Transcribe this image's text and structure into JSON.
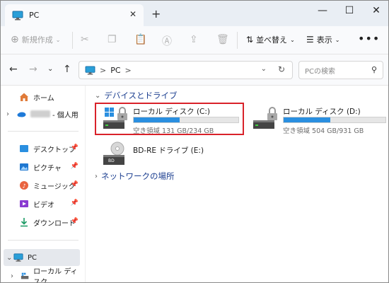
{
  "tab": {
    "title": "PC",
    "close": "✕",
    "new": "+"
  },
  "window_controls": {
    "minimize": "—",
    "maximize": "☐",
    "close": "✕"
  },
  "command_bar": {
    "new_label": "新規作成",
    "sort_label": "並べ替え",
    "view_label": "表示",
    "more_label": "•••"
  },
  "address": {
    "path_root": "PC",
    "sep": ">",
    "search_placeholder": "PCの検索"
  },
  "sidebar": {
    "home": "ホーム",
    "personal_suffix": "- 個人用",
    "pinned": [
      {
        "label": "デスクトップ",
        "icon": "desktop-icon"
      },
      {
        "label": "ピクチャ",
        "icon": "pictures-icon"
      },
      {
        "label": "ミュージック",
        "icon": "music-icon"
      },
      {
        "label": "ビデオ",
        "icon": "video-icon"
      },
      {
        "label": "ダウンロード",
        "icon": "download-icon"
      }
    ],
    "pc": "PC",
    "local_disk": "ローカル ディスク"
  },
  "main": {
    "devices_header": "デバイスとドライブ",
    "network_header": "ネットワークの場所",
    "drives": [
      {
        "name": "ローカル ディスク (C:)",
        "free_text": "空き領域 131 GB/234 GB",
        "used_fraction": 0.44
      },
      {
        "name": "ローカル ディスク (D:)",
        "free_text": "空き領域 504 GB/931 GB",
        "used_fraction": 0.46
      },
      {
        "name": "BD-RE ドライブ (E:)",
        "badge": "BD"
      }
    ]
  },
  "colors": {
    "accent": "#2a8fe0",
    "highlight": "#d9222a",
    "link": "#1a3d8f"
  }
}
